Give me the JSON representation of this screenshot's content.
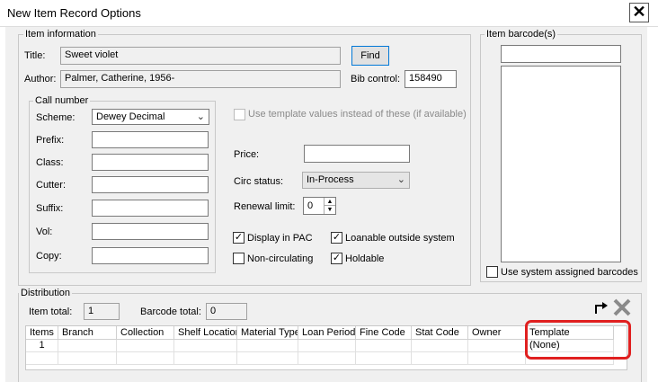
{
  "window": {
    "title": "New Item Record Options",
    "close_glyph": "✕"
  },
  "item_info": {
    "legend": "Item information",
    "title_label": "Title:",
    "title_value": "Sweet violet",
    "author_label": "Author:",
    "author_value": "Palmer, Catherine, 1956-",
    "find_label": "Find",
    "bib_label": "Bib control:",
    "bib_value": "158490"
  },
  "call_number": {
    "legend": "Call number",
    "scheme_label": "Scheme:",
    "scheme_value": "Dewey Decimal",
    "prefix_label": "Prefix:",
    "class_label": "Class:",
    "cutter_label": "Cutter:",
    "suffix_label": "Suffix:",
    "vol_label": "Vol:",
    "copy_label": "Copy:"
  },
  "options": {
    "use_template_label": "Use template values instead of these (if available)",
    "price_label": "Price:",
    "circ_label": "Circ status:",
    "circ_value": "In-Process",
    "renewal_label": "Renewal limit:",
    "renewal_value": "0",
    "display_pac_label": "Display in PAC",
    "display_pac_checked": true,
    "loanable_label": "Loanable outside system",
    "loanable_checked": true,
    "noncirc_label": "Non-circulating",
    "noncirc_checked": false,
    "holdable_label": "Holdable",
    "holdable_checked": true
  },
  "barcode": {
    "legend": "Item barcode(s)",
    "use_system_label": "Use system assigned barcodes",
    "use_system_checked": false
  },
  "distribution": {
    "legend": "Distribution",
    "item_total_label": "Item total:",
    "item_total_value": "1",
    "barcode_total_label": "Barcode total:",
    "barcode_total_value": "0",
    "columns": [
      "Items",
      "Branch",
      "Collection",
      "Shelf Location",
      "Material Type",
      "Loan Period",
      "Fine Code",
      "Stat Code",
      "Owner",
      "Template"
    ],
    "rows": [
      [
        "1",
        "",
        "",
        "",
        "",
        "",
        "",
        "",
        "",
        "(None)"
      ]
    ]
  },
  "colors": {
    "highlight": "#e02020",
    "button_border": "#0078d7",
    "dialog_bg": "#f0f0f0"
  },
  "icons": [
    "close-icon",
    "chevron-down-icon",
    "spin-up-icon",
    "spin-down-icon",
    "checkmark-icon",
    "redirect-arrow-icon",
    "delete-x-icon"
  ]
}
